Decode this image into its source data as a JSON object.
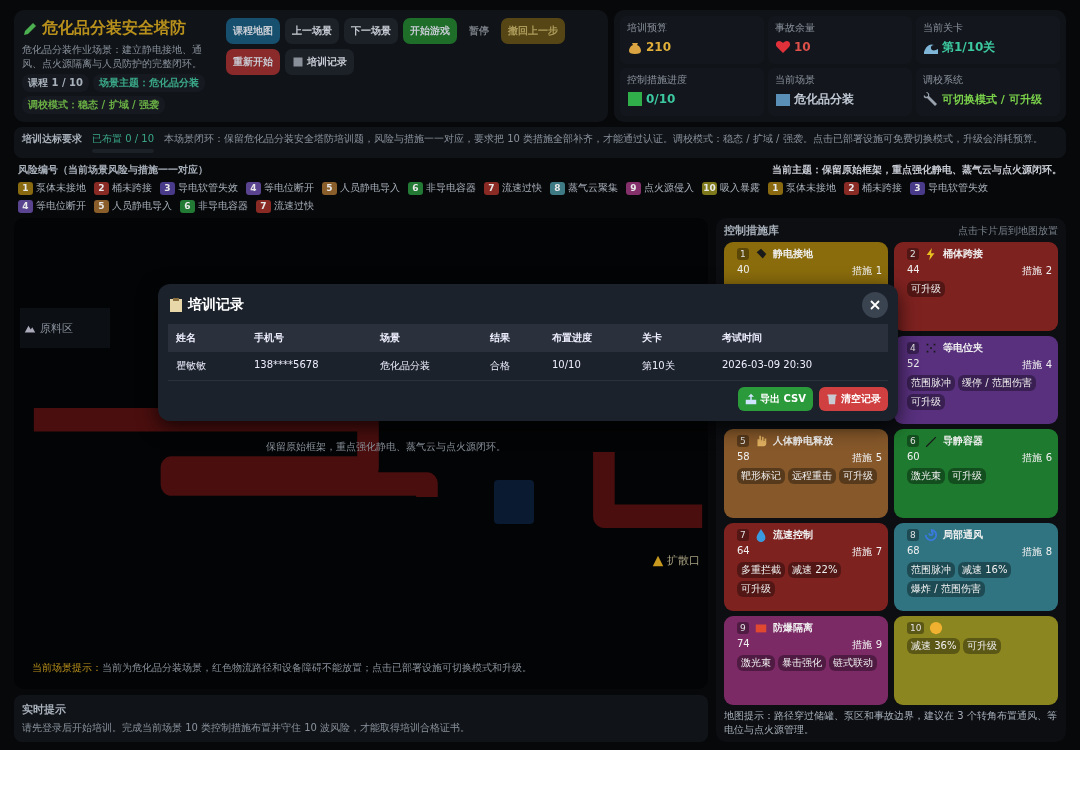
{
  "header": {
    "title": "危化品分装安全塔防",
    "description": "危化品分装作业场景：建立静电接地、通风、点火源隔离与人员防护的完整闭环。",
    "chips": [
      {
        "text": "课程 1 / 10",
        "kind": "plain"
      },
      {
        "text": "场景主题：危化品分装",
        "kind": "theme"
      },
      {
        "text": "调校模式：稳态 / 扩域 / 强袭",
        "kind": "mode"
      }
    ]
  },
  "buttons": [
    {
      "label": "课程地图",
      "kind": "info",
      "disabled": false
    },
    {
      "label": "上一场景",
      "kind": "plain",
      "disabled": false
    },
    {
      "label": "下一场景",
      "kind": "plain",
      "disabled": false
    },
    {
      "label": "开始游戏",
      "kind": "success",
      "disabled": false
    },
    {
      "label": "暂停",
      "kind": "plain",
      "disabled": true
    },
    {
      "label": "撤回上一步",
      "kind": "warn",
      "disabled": true
    },
    {
      "label": "重新开始",
      "kind": "danger",
      "disabled": false
    },
    {
      "label": "培训记录",
      "kind": "records",
      "disabled": false
    }
  ],
  "stats": [
    {
      "label": "培训预算",
      "value": "210"
    },
    {
      "label": "事故余量",
      "value": "10"
    },
    {
      "label": "当前关卡",
      "value": "第1/10关"
    },
    {
      "label": "控制措施进度",
      "value": "0/10"
    },
    {
      "label": "当前场景",
      "value": "危化品分装"
    },
    {
      "label": "调校系统",
      "value": "可切换模式 / 可升级"
    }
  ],
  "requirement": {
    "title": "培训达标要求",
    "progress": "已布置 0 / 10",
    "level": 0,
    "text": "本场景闭环：保留危化品分装安全塔防培训题，风险与措施一一对应，要求把 10 类措施全部补齐，才能通过认证。调校模式：稳态 / 扩域 / 强袭。点击已部署设施可免费切换模式，升级会消耗预算。"
  },
  "risks": {
    "title": "风险编号（当前场景风险与措施一一对应）",
    "theme": "当前主题：保留原始框架，重点强化静电、蒸气云与点火源闭环。",
    "items": [
      {
        "number": "1",
        "label": "泵体未接地",
        "color": "#8a6a10"
      },
      {
        "number": "2",
        "label": "桶未跨接",
        "color": "#8a2a24"
      },
      {
        "number": "3",
        "label": "导电软管失效",
        "color": "#4a3a8a"
      },
      {
        "number": "4",
        "label": "等电位断开",
        "color": "#5a4490"
      },
      {
        "number": "5",
        "label": "人员静电导入",
        "color": "#8a5e2a"
      },
      {
        "number": "6",
        "label": "非导电容器",
        "color": "#237a34"
      },
      {
        "number": "7",
        "label": "流速过快",
        "color": "#8a2a24"
      },
      {
        "number": "8",
        "label": "蒸气云聚集",
        "color": "#3e7a84"
      },
      {
        "number": "9",
        "label": "点火源侵入",
        "color": "#84306a"
      },
      {
        "number": "10",
        "label": "吸入暴露",
        "color": "#7e7a1c"
      },
      {
        "number": "1",
        "label": "泵体未接地",
        "color": "#8a6a10"
      },
      {
        "number": "2",
        "label": "桶未跨接",
        "color": "#8a2a24"
      },
      {
        "number": "3",
        "label": "导电软管失效",
        "color": "#4a3a8a"
      },
      {
        "number": "4",
        "label": "等电位断开",
        "color": "#5a4490"
      },
      {
        "number": "5",
        "label": "人员静电导入",
        "color": "#8a5e2a"
      },
      {
        "number": "6",
        "label": "非导电容器",
        "color": "#237a34"
      },
      {
        "number": "7",
        "label": "流速过快",
        "color": "#8a2a24"
      }
    ]
  },
  "map": {
    "zone": "原料区",
    "banner": "保留原始框架，重点强化静电、蒸气云与点火源闭环。",
    "exit": "扩散口",
    "hint_label": "当前场景提示：",
    "hint": "当前为危化品分装场景，红色物流路径和设备障碍不能放置；点击已部署设施可切换模式和升级。"
  },
  "realtime": {
    "title": "实时提示",
    "text": "请先登录后开始培训。完成当前场景 10 类控制措施布置并守住 10 波风险，才能取得培训合格证书。"
  },
  "library": {
    "title": "控制措施库",
    "hint": "点击卡片后到地图放置",
    "footer": "地图提示：路径穿过储罐、泵区和事故边界，建议在 3 个转角布置通风、等电位与点火源管理。",
    "cards": [
      {
        "number": "1",
        "name": "静电接地",
        "cost": "40",
        "measure": "措施 1",
        "color": "#8a6c0c"
      },
      {
        "number": "2",
        "name": "桶体跨接",
        "cost": "44",
        "measure": "措施 2",
        "color": "#7e2220",
        "tags": [
          "可升级"
        ]
      },
      {
        "number": "4",
        "name": "等电位夹",
        "cost": "52",
        "measure": "措施 4",
        "color": "#58307e",
        "tags": [
          "范围脉冲",
          "缓停 / 范围伤害",
          "可升级"
        ]
      },
      {
        "number": "5",
        "name": "人体静电释放",
        "cost": "58",
        "measure": "措施 5",
        "color": "#86582a",
        "tags": [
          "靶形标记",
          "远程重击",
          "可升级"
        ]
      },
      {
        "number": "6",
        "name": "导静容器",
        "cost": "60",
        "measure": "措施 6",
        "color": "#1e7a2e",
        "tags": [
          "激光束",
          "可升级"
        ]
      },
      {
        "number": "7",
        "name": "流速控制",
        "cost": "64",
        "measure": "措施 7",
        "color": "#7e2220",
        "tags": [
          "多重拦截",
          "减速 22%",
          "可升级"
        ]
      },
      {
        "number": "8",
        "name": "局部通风",
        "cost": "68",
        "measure": "措施 8",
        "color": "#2f7480",
        "tags": [
          "范围脉冲",
          "减速 16%",
          "爆炸 / 范围伤害"
        ]
      },
      {
        "number": "9",
        "name": "防爆隔离",
        "cost": "74",
        "measure": "措施 9",
        "color": "#7c2a66",
        "tags": [
          "激光束",
          "暴击强化",
          "链式联动"
        ]
      },
      {
        "number": "10",
        "color": "#8c8620",
        "tags": [
          "减速 36%",
          "可升级"
        ]
      }
    ]
  },
  "modal": {
    "title": "培训记录",
    "columns": [
      "姓名",
      "手机号",
      "场景",
      "结果",
      "布置进度",
      "关卡",
      "考试时间"
    ],
    "rows": [
      [
        "瞿敏敏",
        "138****5678",
        "危化品分装",
        "合格",
        "10/10",
        "第10关",
        "2026-03-09 20:30"
      ]
    ],
    "buttons": [
      {
        "label": "导出 CSV",
        "kind": "export"
      },
      {
        "label": "清空记录",
        "kind": "clear"
      }
    ]
  }
}
